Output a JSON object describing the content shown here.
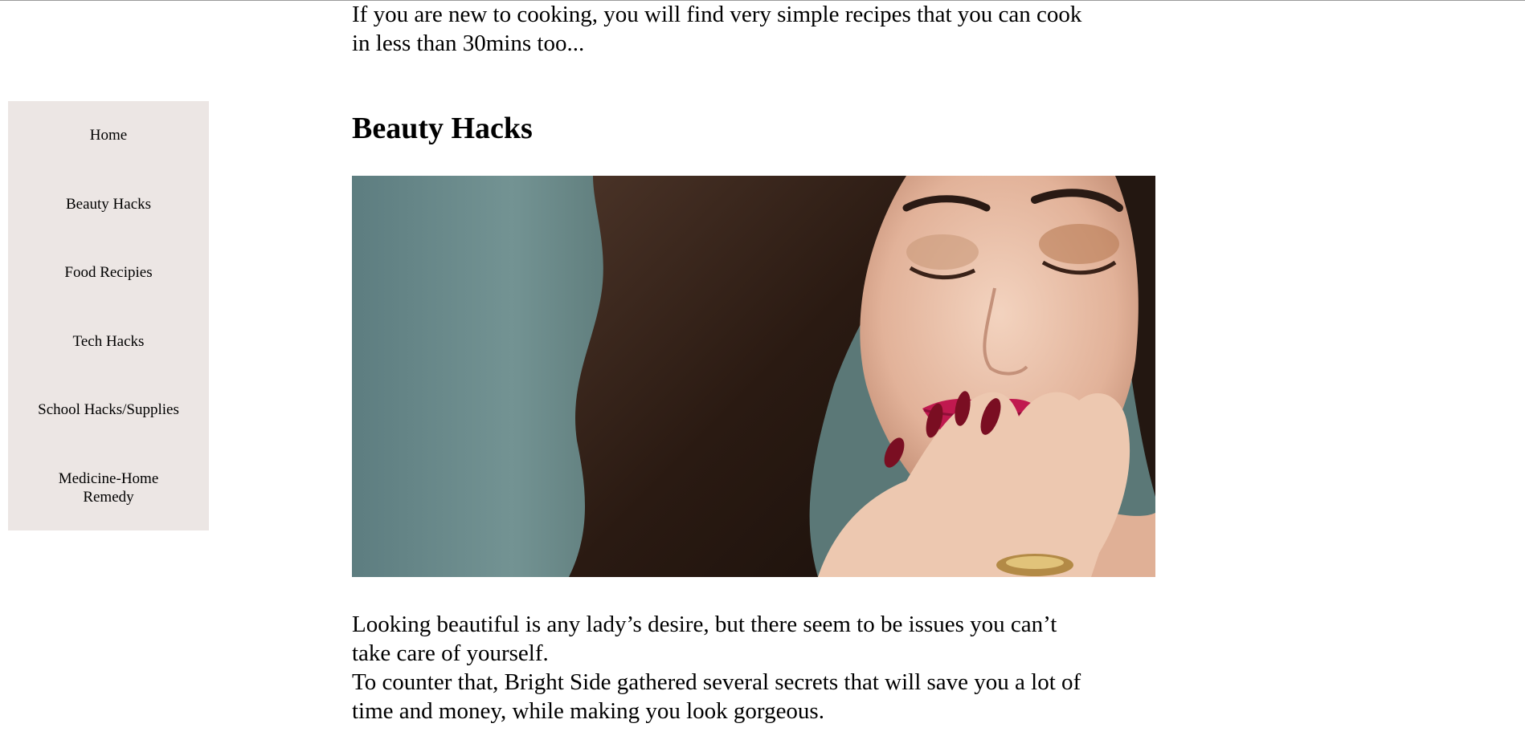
{
  "intro": {
    "line1": "If you are new to cooking, you will find very simple recipes that you can cook",
    "line2": "in less than 30mins too..."
  },
  "nav": {
    "items": [
      {
        "label": "Home"
      },
      {
        "label": "Beauty Hacks"
      },
      {
        "label": "Food Recipies"
      },
      {
        "label": "Tech Hacks"
      },
      {
        "label": "School Hacks/Supplies"
      },
      {
        "label": "Medicine-Home"
      },
      {
        "label": "Remedy"
      }
    ]
  },
  "section": {
    "heading": "Beauty Hacks",
    "paragraph": {
      "line1": "Looking beautiful is any lady’s desire, but there seem to be issues you can’t",
      "line2": "take care of yourself.",
      "line3": "To counter that, Bright Side gathered several secrets that will save you a lot of",
      "line4": "time and money, while making you look gorgeous."
    }
  },
  "colors": {
    "sidebar_bg": "#ece6e4",
    "text": "#000000",
    "lip": "#c0194f",
    "nail": "#7a0e22"
  }
}
